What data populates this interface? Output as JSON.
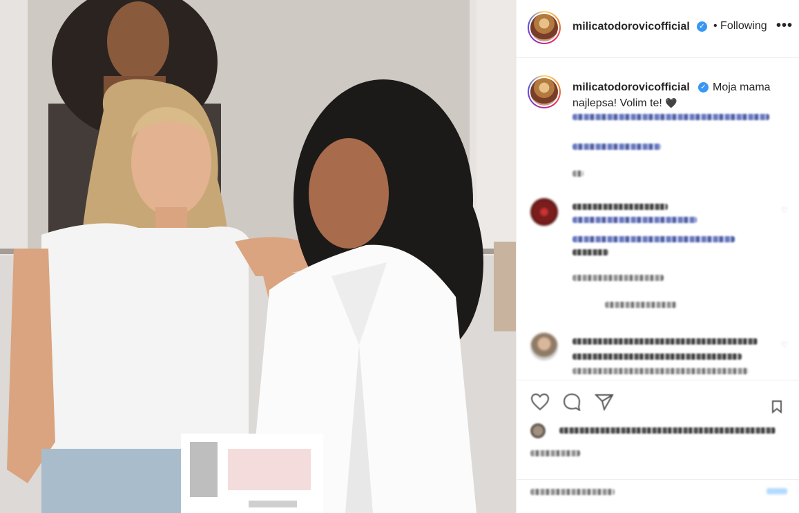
{
  "post": {
    "username": "milicatodorovicofficial",
    "verified_mark": "✓",
    "follow_status": "• Following",
    "more_label": "•••"
  },
  "caption": {
    "username": "milicatodorovicofficial",
    "text": "Moja mama najlepsa! Volim te! ",
    "heart": "🖤"
  },
  "icons": {
    "header_avatar": "avatar",
    "verified": "verified-badge",
    "more": "more-options-icon",
    "like": "heart-icon",
    "comment": "comment-icon",
    "share": "share-icon",
    "save": "bookmark-icon"
  },
  "colors": {
    "verified_blue": "#3897f0",
    "text": "#262626",
    "divider": "#efefef"
  }
}
